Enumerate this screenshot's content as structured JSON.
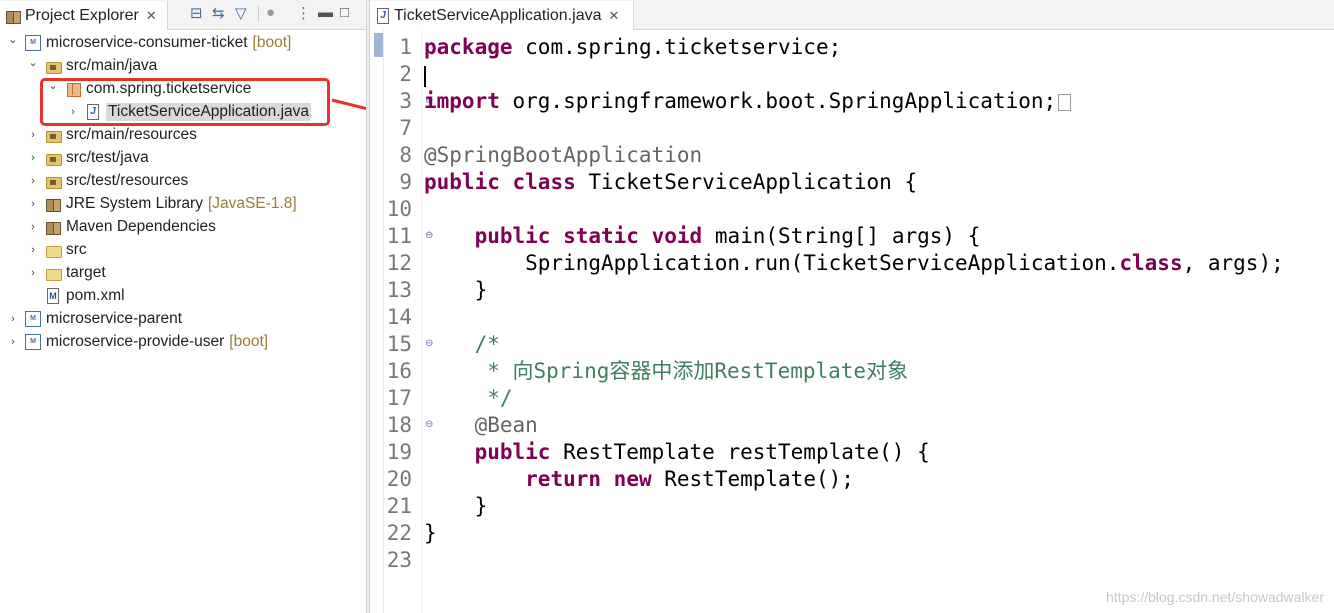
{
  "explorer": {
    "tab_title": "Project Explorer",
    "close_glyph": "✕",
    "toolbar_icons": [
      "collapse-all-icon",
      "link-with-editor-icon",
      "filter-icon",
      "view-menu-icon",
      "more-icon",
      "minimize-icon",
      "maximize-icon"
    ],
    "tree": [
      {
        "label": "microservice-consumer-ticket",
        "suffix": "[boot]",
        "expanded": true,
        "icon": "project-icon"
      },
      {
        "label": "src/main/java",
        "suffix": "",
        "expanded": true,
        "icon": "source-folder-icon"
      },
      {
        "label": "com.spring.ticketservice",
        "suffix": "",
        "expanded": true,
        "icon": "package-icon"
      },
      {
        "label": "TicketServiceApplication.java",
        "suffix": "",
        "expanded": false,
        "icon": "java-file-icon",
        "selected": true
      },
      {
        "label": "src/main/resources",
        "suffix": "",
        "expanded": false,
        "icon": "source-folder-icon"
      },
      {
        "label": "src/test/java",
        "suffix": "",
        "expanded": false,
        "icon": "source-folder-icon"
      },
      {
        "label": "src/test/resources",
        "suffix": "",
        "expanded": false,
        "icon": "source-folder-icon"
      },
      {
        "label": "JRE System Library",
        "suffix": "[JavaSE-1.8]",
        "expanded": false,
        "icon": "library-icon"
      },
      {
        "label": "Maven Dependencies",
        "suffix": "",
        "expanded": false,
        "icon": "library-icon"
      },
      {
        "label": "src",
        "suffix": "",
        "expanded": false,
        "icon": "folder-icon"
      },
      {
        "label": "target",
        "suffix": "",
        "expanded": false,
        "icon": "folder-icon"
      },
      {
        "label": "pom.xml",
        "suffix": "",
        "expanded": false,
        "icon": "maven-pom-icon"
      },
      {
        "label": "microservice-parent",
        "suffix": "",
        "expanded": false,
        "icon": "project-icon"
      },
      {
        "label": "microservice-provide-user",
        "suffix": "[boot]",
        "expanded": false,
        "icon": "project-icon"
      }
    ]
  },
  "editor": {
    "tab_title": "TicketServiceApplication.java",
    "close_glyph": "✕",
    "lines": [
      {
        "n": "1",
        "tokens": [
          {
            "t": "package",
            "k": "kw"
          },
          {
            "t": " com.spring.ticketservice;",
            "k": ""
          }
        ]
      },
      {
        "n": "2",
        "tokens": []
      },
      {
        "n": "3",
        "fold": "⊕",
        "tokens": [
          {
            "t": "import",
            "k": "kw"
          },
          {
            "t": " org.springframework.boot.SpringApplication;",
            "k": ""
          }
        ],
        "folded": true
      },
      {
        "n": "7",
        "tokens": []
      },
      {
        "n": "8",
        "tokens": [
          {
            "t": "@SpringBootApplication",
            "k": "annot"
          }
        ]
      },
      {
        "n": "9",
        "tokens": [
          {
            "t": "public",
            "k": "kw"
          },
          {
            "t": " ",
            "k": ""
          },
          {
            "t": "class",
            "k": "kw"
          },
          {
            "t": " TicketServiceApplication {",
            "k": ""
          }
        ]
      },
      {
        "n": "10",
        "tokens": []
      },
      {
        "n": "11",
        "fold": "⊖",
        "tokens": [
          {
            "t": "    ",
            "k": ""
          },
          {
            "t": "public",
            "k": "kw"
          },
          {
            "t": " ",
            "k": ""
          },
          {
            "t": "static",
            "k": "kw"
          },
          {
            "t": " ",
            "k": ""
          },
          {
            "t": "void",
            "k": "kw"
          },
          {
            "t": " main(String[] args) {",
            "k": ""
          }
        ]
      },
      {
        "n": "12",
        "tokens": [
          {
            "t": "        SpringApplication.run(TicketServiceApplication.",
            "k": ""
          },
          {
            "t": "class",
            "k": "kw"
          },
          {
            "t": ", args);",
            "k": ""
          }
        ]
      },
      {
        "n": "13",
        "tokens": [
          {
            "t": "    }",
            "k": ""
          }
        ]
      },
      {
        "n": "14",
        "tokens": []
      },
      {
        "n": "15",
        "fold": "⊖",
        "tokens": [
          {
            "t": "    /*",
            "k": "cm"
          }
        ]
      },
      {
        "n": "16",
        "tokens": [
          {
            "t": "     * 向Spring容器中添加RestTemplate对象",
            "k": "cm"
          }
        ]
      },
      {
        "n": "17",
        "tokens": [
          {
            "t": "     */",
            "k": "cm"
          }
        ]
      },
      {
        "n": "18",
        "fold": "⊖",
        "tokens": [
          {
            "t": "    @Bean",
            "k": "annot"
          }
        ]
      },
      {
        "n": "19",
        "tokens": [
          {
            "t": "    ",
            "k": ""
          },
          {
            "t": "public",
            "k": "kw"
          },
          {
            "t": " RestTemplate restTemplate() {",
            "k": ""
          }
        ]
      },
      {
        "n": "20",
        "tokens": [
          {
            "t": "        ",
            "k": ""
          },
          {
            "t": "return",
            "k": "kw"
          },
          {
            "t": " ",
            "k": ""
          },
          {
            "t": "new",
            "k": "kw"
          },
          {
            "t": " RestTemplate();",
            "k": ""
          }
        ]
      },
      {
        "n": "21",
        "tokens": [
          {
            "t": "    }",
            "k": ""
          }
        ]
      },
      {
        "n": "22",
        "tokens": [
          {
            "t": "}",
            "k": ""
          }
        ]
      },
      {
        "n": "23",
        "tokens": []
      }
    ]
  },
  "annotation": {
    "highlight_color": "#e8312a"
  },
  "watermark": "https://blog.csdn.net/showadwalker"
}
